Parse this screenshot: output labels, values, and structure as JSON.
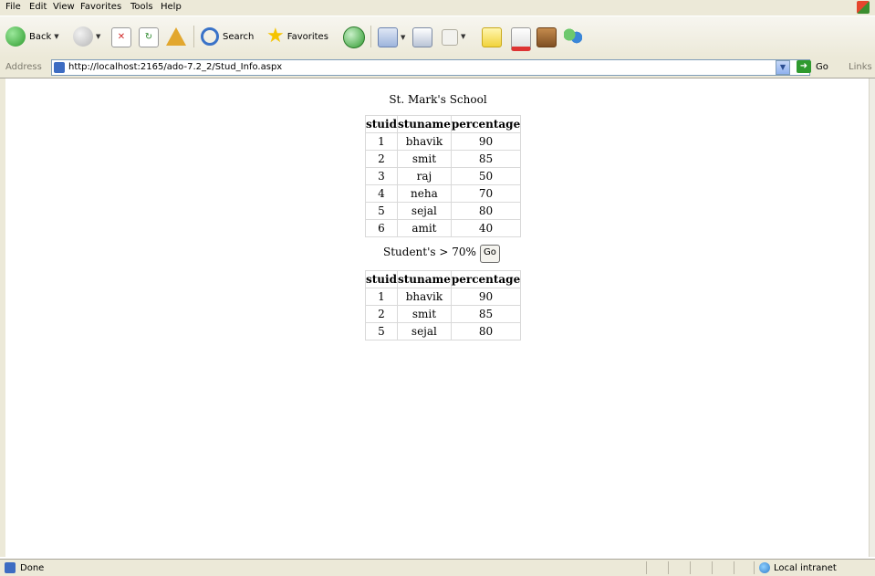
{
  "menu": [
    "File",
    "Edit",
    "View",
    "Favorites",
    "Tools",
    "Help"
  ],
  "toolbar": {
    "back_label": "Back",
    "search_label": "Search",
    "favorites_label": "Favorites"
  },
  "address": {
    "label": "Address",
    "url": "http://localhost:2165/ado-7.2_2/Stud_Info.aspx",
    "go_label": "Go",
    "links_label": "Links"
  },
  "page": {
    "title": "St. Mark's School",
    "headers": [
      "stuid",
      "stuname",
      "percentage"
    ],
    "rows": [
      [
        "1",
        "bhavik",
        "90"
      ],
      [
        "2",
        "smit",
        "85"
      ],
      [
        "3",
        "raj",
        "50"
      ],
      [
        "4",
        "neha",
        "70"
      ],
      [
        "5",
        "sejal",
        "80"
      ],
      [
        "6",
        "amit",
        "40"
      ]
    ],
    "filter_label": "Student's > 70%",
    "filter_button": "Go",
    "filtered_rows": [
      [
        "1",
        "bhavik",
        "90"
      ],
      [
        "2",
        "smit",
        "85"
      ],
      [
        "5",
        "sejal",
        "80"
      ]
    ]
  },
  "status": {
    "text": "Done",
    "zone": "Local intranet"
  }
}
